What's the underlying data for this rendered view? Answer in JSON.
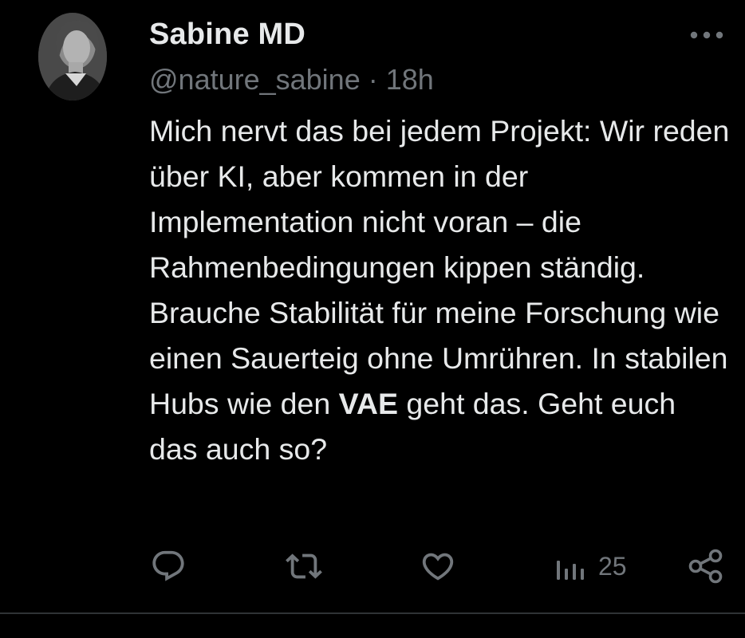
{
  "tweet": {
    "author": {
      "display_name": "Sabine MD",
      "handle": "@nature_sabine",
      "separator": "·",
      "time": "18h"
    },
    "text": {
      "before_bold": "Mich nervt das bei jedem Projekt: Wir reden über KI, aber kommen in der Implementation nicht voran – die Rahmenbedingungen kippen ständig. Brauche Stabilität für meine Forschung wie einen Sauerteig ohne Umrühren. In stabilen Hubs wie den ",
      "bold": "VAE",
      "after_bold": " geht das. Geht euch das auch so?"
    },
    "actions": {
      "reply_icon": "reply-icon",
      "retweet_icon": "retweet-icon",
      "like_icon": "heart-icon",
      "views_icon": "bar-chart-icon",
      "views_count": "25",
      "share_icon": "share-icon"
    },
    "more_icon": "ellipsis-icon"
  },
  "colors": {
    "background": "#000000",
    "primary_text": "#e7e9ea",
    "secondary_text": "#71767b",
    "divider": "#2f3336"
  }
}
